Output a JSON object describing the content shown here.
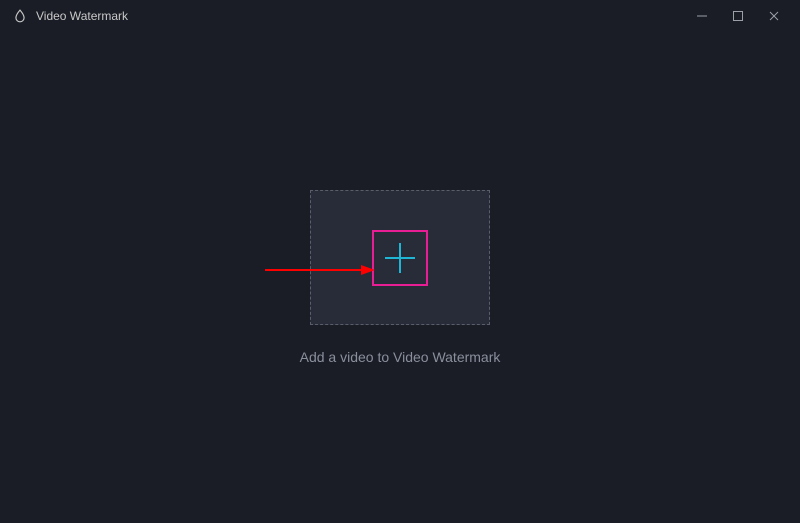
{
  "titlebar": {
    "title": "Video Watermark"
  },
  "main": {
    "hint": "Add a video to Video Watermark"
  },
  "colors": {
    "accent_magenta": "#e91e94",
    "plus_cyan": "#1fb6d6",
    "arrow_red": "#ff0000"
  }
}
